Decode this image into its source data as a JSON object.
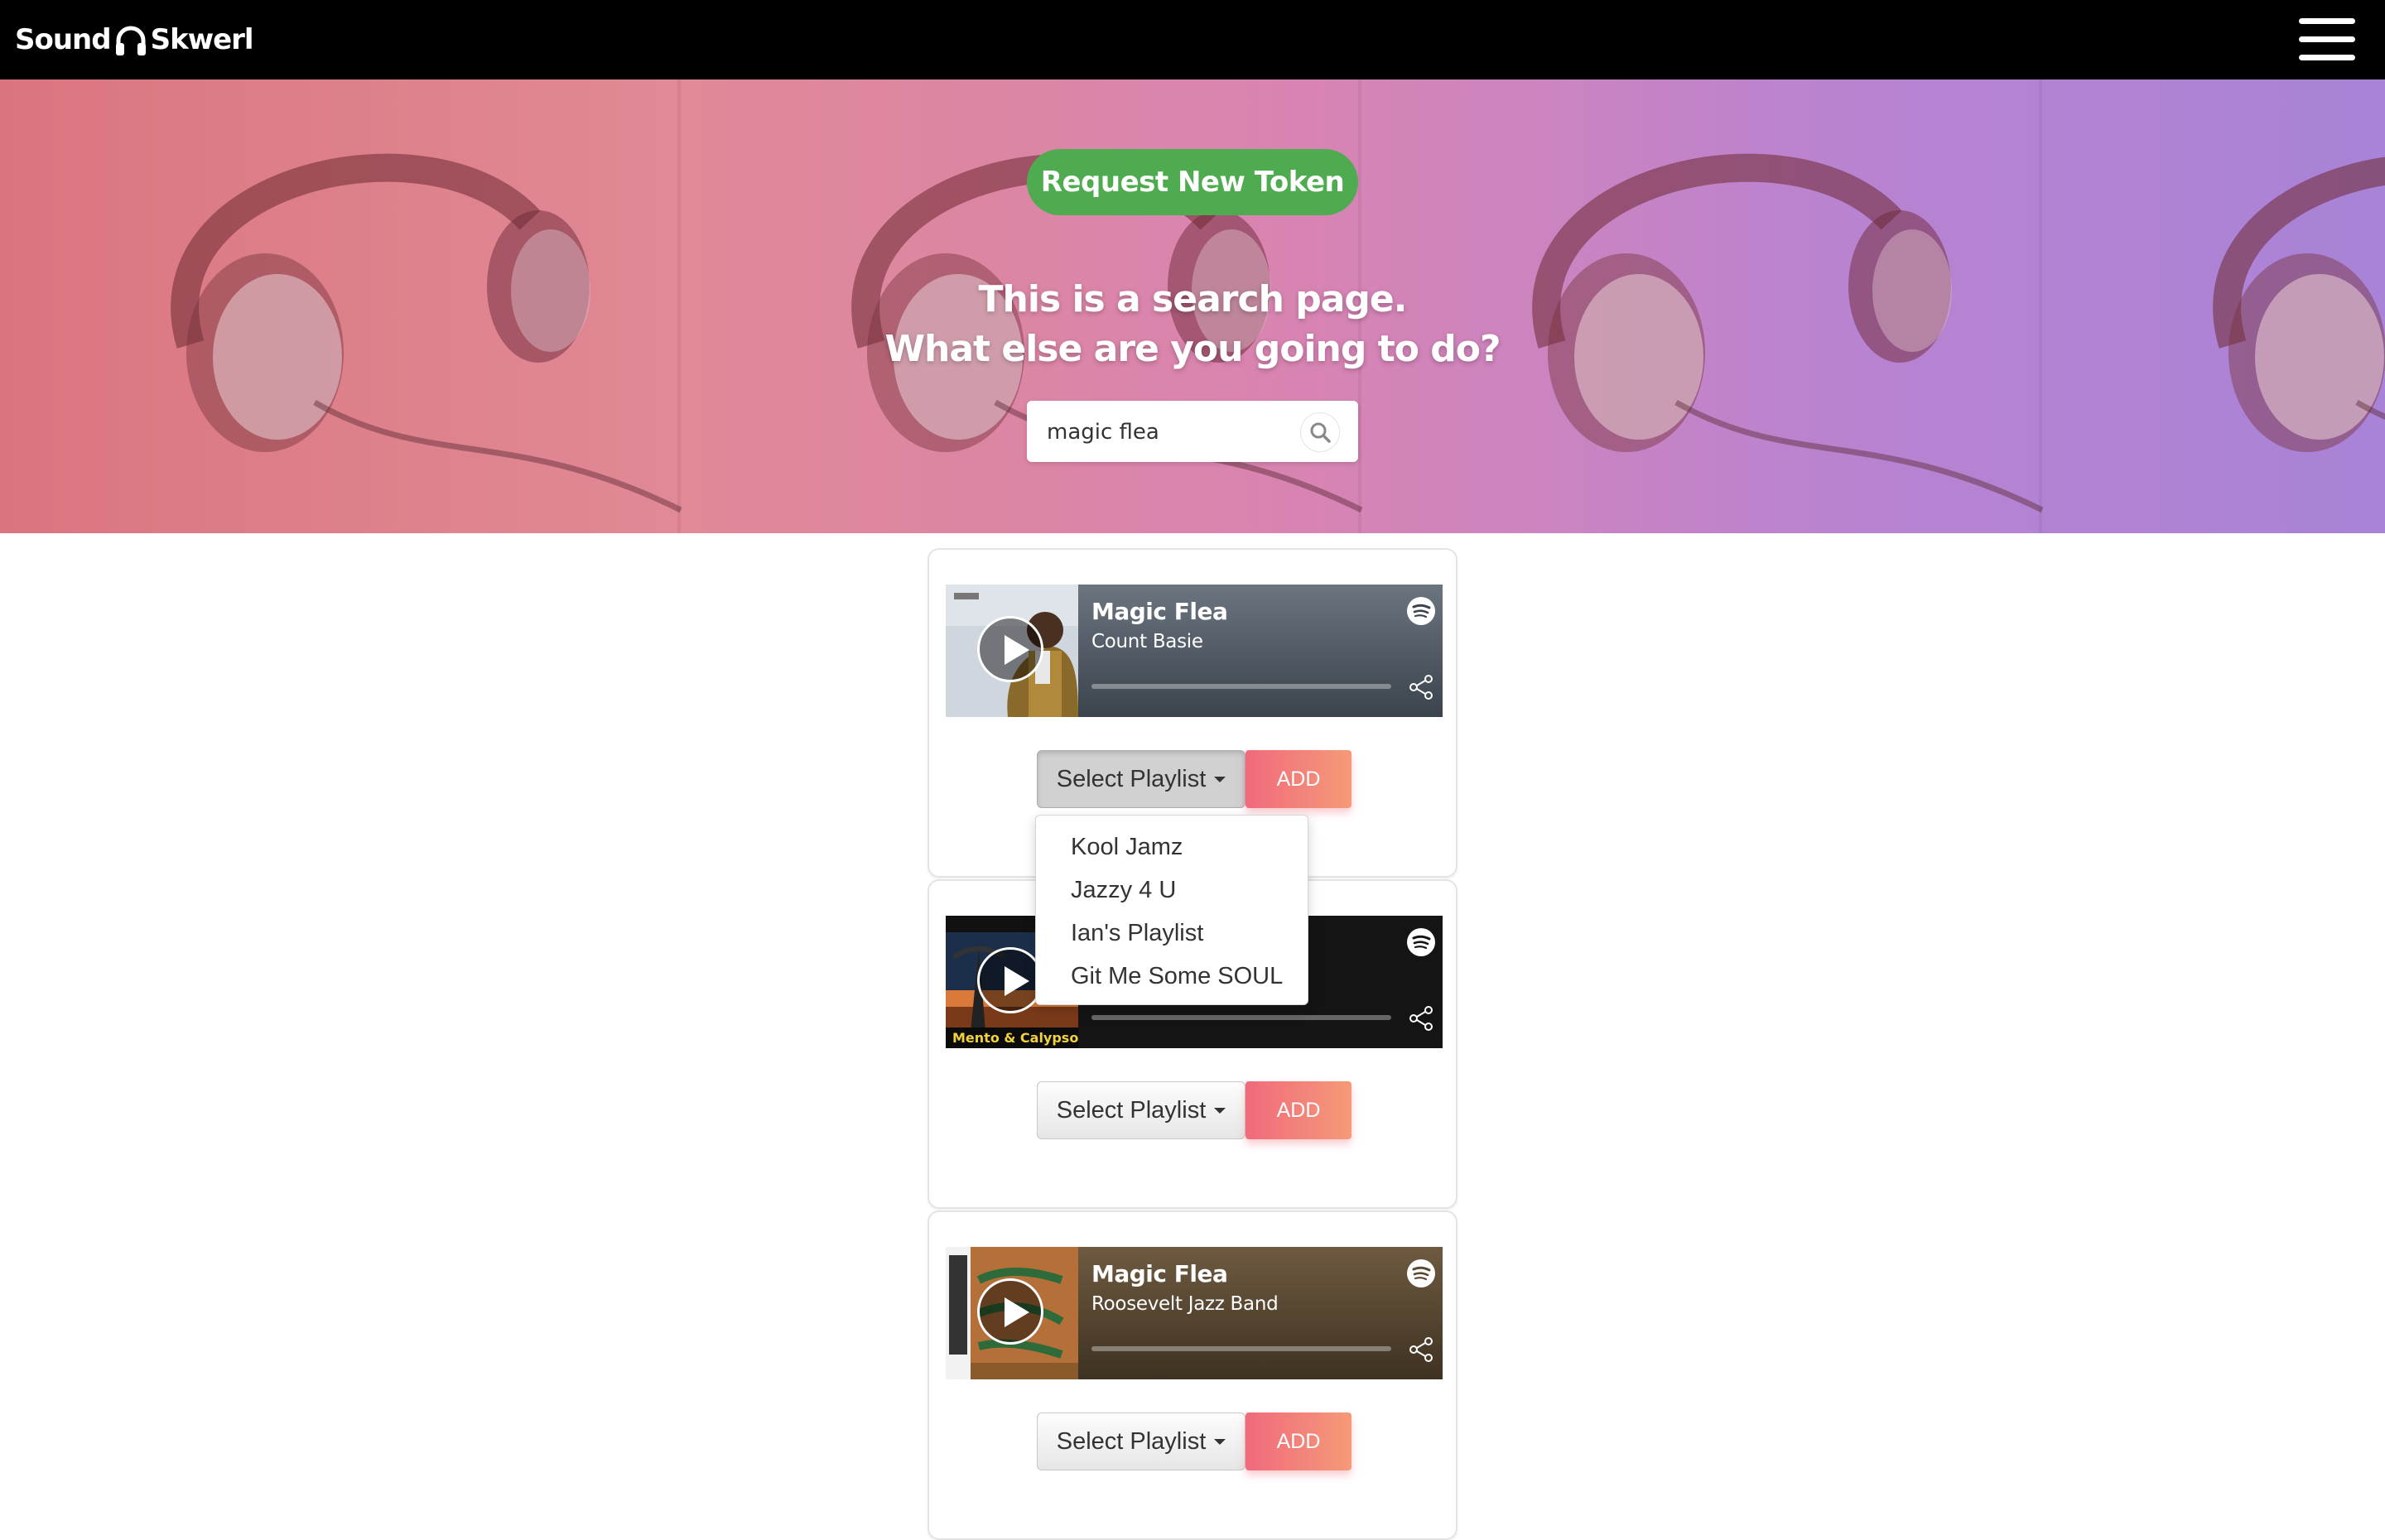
{
  "header": {
    "brand_left": "Sound",
    "brand_right": "Skwerl",
    "brand_icon": "headphones-icon",
    "menu_icon": "hamburger-menu-icon"
  },
  "hero": {
    "token_button": "Request New Token",
    "title_line1": "This is a search page.",
    "title_line2": "What else are you going to do?",
    "search_value": "magic flea",
    "search_icon": "search-icon"
  },
  "colors": {
    "topbar": "#000000",
    "token_button": "#4eab4f",
    "add_button_start": "#f06a7c",
    "add_button_end": "#f59a78"
  },
  "results": [
    {
      "title": "Magic Flea",
      "artist": "Count Basie",
      "select_label": "Select Playlist",
      "add_label": "ADD"
    },
    {
      "title": "",
      "artist": "",
      "select_label": "Select Playlist",
      "add_label": "ADD",
      "art_text": "Mento & Calypso"
    },
    {
      "title": "Magic Flea",
      "artist": "Roosevelt Jazz Band",
      "select_label": "Select Playlist",
      "add_label": "ADD"
    }
  ],
  "playlist_dropdown": {
    "items": [
      "Kool Jamz",
      "Jazzy 4 U",
      "Ian's Playlist",
      "Git Me Some SOUL"
    ]
  }
}
